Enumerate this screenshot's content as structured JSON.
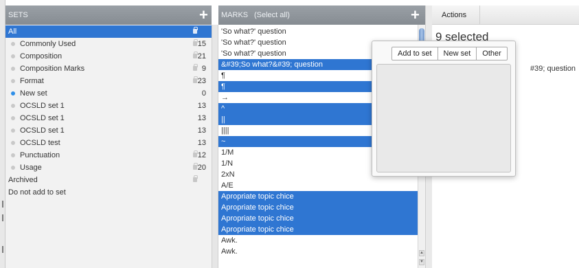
{
  "sets_panel": {
    "header": "SETS",
    "rows": [
      {
        "label": "All",
        "count": "",
        "dot": "none",
        "lock": true,
        "selected": true
      },
      {
        "label": "Commonly Used",
        "count": "15",
        "dot": "gray",
        "lock": true,
        "selected": false
      },
      {
        "label": "Composition",
        "count": "21",
        "dot": "gray",
        "lock": true,
        "selected": false
      },
      {
        "label": "Composition Marks",
        "count": "9",
        "dot": "gray",
        "lock": true,
        "selected": false
      },
      {
        "label": "Format",
        "count": "23",
        "dot": "gray",
        "lock": true,
        "selected": false
      },
      {
        "label": "New set",
        "count": "0",
        "dot": "blue",
        "lock": false,
        "selected": false
      },
      {
        "label": "OCSLD set 1",
        "count": "13",
        "dot": "gray",
        "lock": false,
        "selected": false
      },
      {
        "label": "OCSLD set 1",
        "count": "13",
        "dot": "gray",
        "lock": false,
        "selected": false
      },
      {
        "label": "OCSLD set 1",
        "count": "13",
        "dot": "gray",
        "lock": false,
        "selected": false
      },
      {
        "label": "OCSLD test",
        "count": "13",
        "dot": "gray",
        "lock": false,
        "selected": false
      },
      {
        "label": "Punctuation",
        "count": "12",
        "dot": "gray",
        "lock": true,
        "selected": false
      },
      {
        "label": "Usage",
        "count": "20",
        "dot": "gray",
        "lock": true,
        "selected": false
      },
      {
        "label": "Archived",
        "count": "",
        "dot": "none",
        "lock": true,
        "selected": false
      },
      {
        "label": "Do not add to set",
        "count": "",
        "dot": "none",
        "lock": false,
        "selected": false
      }
    ]
  },
  "marks_panel": {
    "header": "MARKS",
    "select_all": "(Select all)",
    "rows": [
      {
        "label": "'So what?' question",
        "selected": false
      },
      {
        "label": "'So what?' question",
        "selected": false
      },
      {
        "label": "'So what?' question",
        "selected": false
      },
      {
        "label": "&#39;So what?&#39; question",
        "selected": true
      },
      {
        "label": "¶",
        "selected": false
      },
      {
        "label": "¶",
        "selected": true
      },
      {
        "label": "→",
        "selected": false
      },
      {
        "label": "^",
        "selected": true
      },
      {
        "label": "||",
        "selected": true
      },
      {
        "label": "||||",
        "selected": false
      },
      {
        "label": "~",
        "selected": true
      },
      {
        "label": "1/M",
        "selected": false
      },
      {
        "label": "1/N",
        "selected": false
      },
      {
        "label": "2xN",
        "selected": false
      },
      {
        "label": "A/E",
        "selected": false
      },
      {
        "label": "Apropriate topic chice",
        "selected": true
      },
      {
        "label": "Apropriate topic chice",
        "selected": true
      },
      {
        "label": "Apropriate topic chice",
        "selected": true
      },
      {
        "label": "Apropriate topic chice",
        "selected": true
      },
      {
        "label": "Awk.",
        "selected": false
      },
      {
        "label": "Awk.",
        "selected": false
      }
    ]
  },
  "actions_panel": {
    "tab_label": "Actions",
    "selected_text": "9 selected",
    "partial_text": "#39; question"
  },
  "popup": {
    "buttons": [
      "Add to set",
      "New set",
      "Other"
    ]
  },
  "icons": {
    "add_set": "plus-icon",
    "add_mark": "plus-icon",
    "lock": "lock-icon"
  },
  "colors": {
    "selection": "#2f76d2",
    "header_bg": "#8e949a",
    "new_set_dot": "#2f8fe8"
  }
}
